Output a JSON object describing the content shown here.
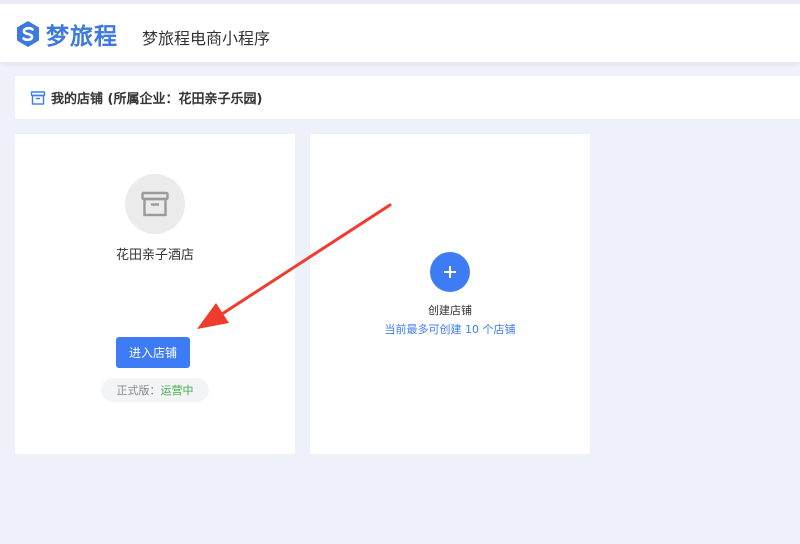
{
  "header": {
    "logo_text": "梦旅程",
    "app_title": "梦旅程电商小程序",
    "logo_icon": "brand-s-logo-icon"
  },
  "section": {
    "title": "我的店铺 (所属企业：花田亲子乐园)",
    "icon": "store-icon"
  },
  "store_card": {
    "name": "花田亲子酒店",
    "enter_label": "进入店铺",
    "version_label": "正式版：",
    "status_label": "运营中",
    "avatar_icon": "store-icon"
  },
  "create_card": {
    "add_icon": "plus-icon",
    "label": "创建店铺",
    "limit_text": "当前最多可创建 10 个店铺"
  },
  "colors": {
    "accent": "#3d7cf5",
    "brand": "#3d79e0",
    "status_green": "#3fae4b",
    "annotation_arrow": "#f03c2e",
    "page_background": "#eef1f9"
  }
}
